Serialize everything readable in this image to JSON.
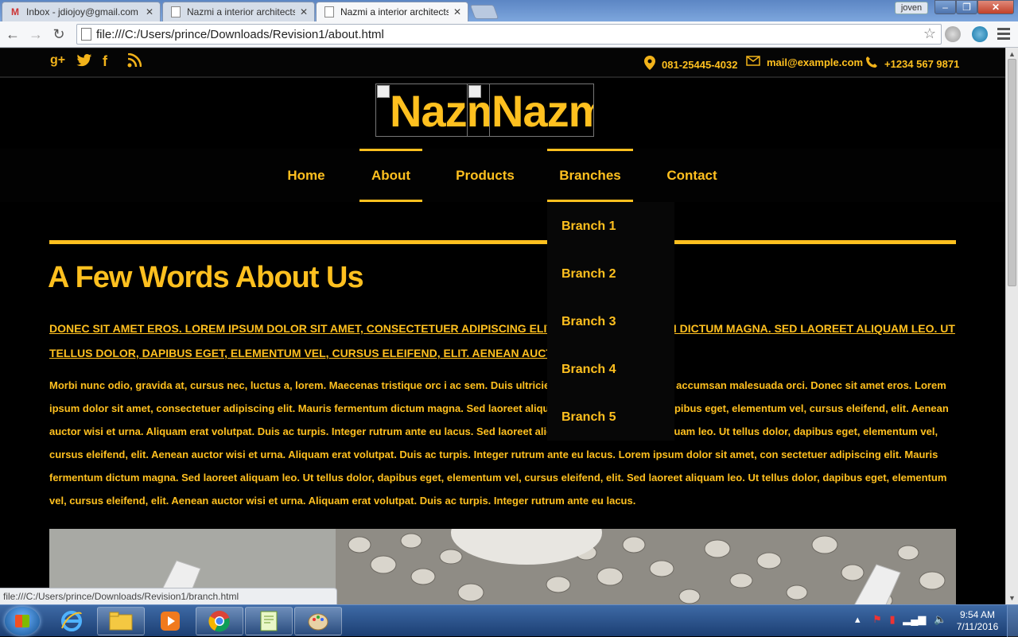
{
  "browser": {
    "tabs": [
      {
        "title": "Inbox - jdiojoy@gmail.com",
        "icon": "gmail-icon"
      },
      {
        "title": "Nazmi a interior architects",
        "icon": "page-icon"
      },
      {
        "title": "Nazmi a interior architects",
        "icon": "page-icon",
        "active": true
      }
    ],
    "user_badge": "joven",
    "url": "file:///C:/Users/prince/Downloads/Revision1/about.html",
    "status_url": "file:///C:/Users/prince/Downloads/Revision1/branch.html"
  },
  "page": {
    "topbar": {
      "phone_landline": "081-25445-4032",
      "email": "mail@example.com",
      "phone_mobile": "+1234 567 9871"
    },
    "logo": {
      "text": "Nazmi"
    },
    "nav": [
      "Home",
      "About",
      "Products",
      "Branches",
      "Contact"
    ],
    "branches_menu": [
      "Branch 1",
      "Branch 2",
      "Branch 3",
      "Branch 4",
      "Branch 5"
    ],
    "heading": "A Few Words About Us",
    "lead": "Donec sit amet eros. Lorem ipsum dolor sit amet, consectetuer adipiscing elit. Mauris fermentum dictum magna. Sed laoreet aliquam leo. Ut tellus dolor, dapibus eget, elementum vel, cursus eleifend, elit. Aenean auctor wisi et urna.",
    "body": "Morbi nunc odio, gravida at, cursus nec, luctus a, lorem. Maecenas tristique orc i ac sem. Duis ultricies pharetra magna. Donec accumsan malesuada orci. Donec sit amet eros. Lorem ipsum dolor sit amet, consectetuer adipiscing elit. Mauris fermentum dictum magna. Sed laoreet aliquam leo. Ut tellus dolor, dapibus eget, elementum vel, cursus eleifend, elit. Aenean auctor wisi et urna. Aliquam erat volutpat. Duis ac turpis. Integer rutrum ante eu lacus. Sed laoreet aliquam leo. Sed laoreet aliquam leo. Ut tellus dolor, dapibus eget, elementum vel, cursus eleifend, elit. Aenean auctor wisi et urna. Aliquam erat volutpat. Duis ac turpis. Integer rutrum ante eu lacus. Lorem ipsum dolor sit amet, con sectetuer adipiscing elit. Mauris fermentum dictum magna. Sed laoreet aliquam leo. Ut tellus dolor, dapibus eget, elementum vel, cursus eleifend, elit. Sed laoreet aliquam leo. Ut tellus dolor, dapibus eget, elementum vel, cursus eleifend, elit. Aenean auctor wisi et urna. Aliquam erat volutpat. Duis ac turpis. Integer rutrum ante eu lacus."
  },
  "taskbar": {
    "time": "9:54 AM",
    "date": "7/11/2016"
  },
  "colors": {
    "accent": "#ffc01f",
    "background": "#000000"
  }
}
